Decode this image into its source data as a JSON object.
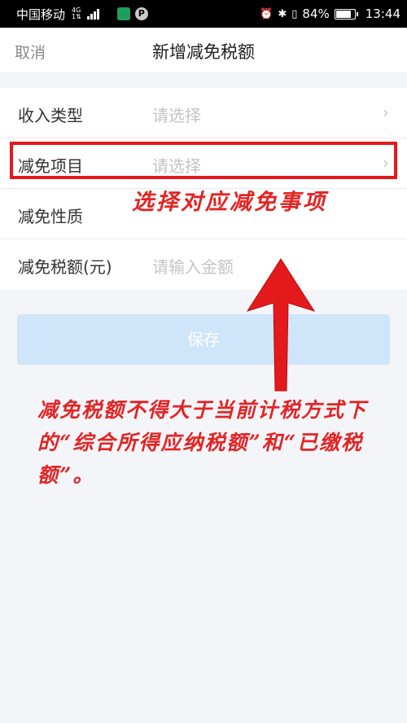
{
  "status_bar": {
    "carrier": "中国移动",
    "net_type": "4G",
    "net_sub": "1⇅",
    "battery": "84%",
    "battery_level": 0.84,
    "time": "13:44"
  },
  "nav": {
    "cancel_label": "取消",
    "title": "新增减免税额"
  },
  "form": {
    "rows": [
      {
        "label": "收入类型",
        "value": "请选择",
        "chevron": "›"
      },
      {
        "label": "减免项目",
        "value": "请选择",
        "chevron": "›"
      },
      {
        "label": "减免性质",
        "value": "",
        "chevron": ""
      },
      {
        "label": "减免税额(元)",
        "value": "请输入金额",
        "chevron": ""
      }
    ]
  },
  "save_label": "保存",
  "annotations": {
    "select_note": "选择对应减免事项",
    "limit_note": "减免税额不得大于当前计税方式下的“综合所得应纳税额”和“已缴税额”。"
  },
  "colors": {
    "annotation_red": "#e22424",
    "save_bg": "#cfe5f9",
    "placeholder": "#c4c4c4"
  }
}
